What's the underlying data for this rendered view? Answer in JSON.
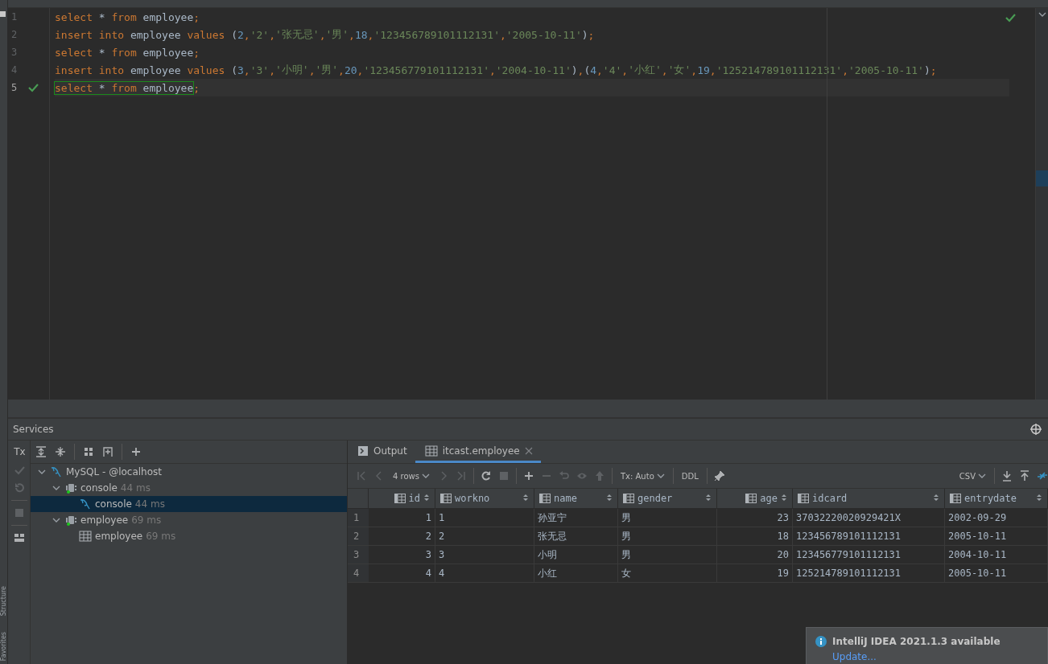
{
  "side_stripe": {
    "tabs": [
      {
        "label": "Structure"
      },
      {
        "label": "Favorites"
      }
    ]
  },
  "editor": {
    "lines": [
      {
        "number": "1",
        "executed": false,
        "tokens": [
          {
            "kind": "kw",
            "text": "select "
          },
          {
            "kind": "id",
            "text": "* "
          },
          {
            "kind": "kw",
            "text": "from "
          },
          {
            "kind": "id",
            "text": "employee"
          },
          {
            "kind": "op",
            "text": ";"
          }
        ]
      },
      {
        "number": "2",
        "executed": false,
        "tokens": [
          {
            "kind": "kw",
            "text": "insert into "
          },
          {
            "kind": "id",
            "text": "employee "
          },
          {
            "kind": "kw",
            "text": "values "
          },
          {
            "kind": "paren",
            "text": "("
          },
          {
            "kind": "num",
            "text": "2"
          },
          {
            "kind": "op",
            "text": ","
          },
          {
            "kind": "str",
            "text": "'2'"
          },
          {
            "kind": "op",
            "text": ","
          },
          {
            "kind": "str",
            "text": "'张无忌'"
          },
          {
            "kind": "op",
            "text": ","
          },
          {
            "kind": "str",
            "text": "'男'"
          },
          {
            "kind": "op",
            "text": ","
          },
          {
            "kind": "num",
            "text": "18"
          },
          {
            "kind": "op",
            "text": ","
          },
          {
            "kind": "str",
            "text": "'123456789101112131'"
          },
          {
            "kind": "op",
            "text": ","
          },
          {
            "kind": "str",
            "text": "'2005-10-11'"
          },
          {
            "kind": "paren",
            "text": ")"
          },
          {
            "kind": "op",
            "text": ";"
          }
        ]
      },
      {
        "number": "3",
        "executed": false,
        "tokens": [
          {
            "kind": "kw",
            "text": "select "
          },
          {
            "kind": "id",
            "text": "* "
          },
          {
            "kind": "kw",
            "text": "from "
          },
          {
            "kind": "id",
            "text": "employee"
          },
          {
            "kind": "op",
            "text": ";"
          }
        ]
      },
      {
        "number": "4",
        "executed": false,
        "tokens": [
          {
            "kind": "kw",
            "text": "insert into "
          },
          {
            "kind": "id",
            "text": "employee "
          },
          {
            "kind": "kw",
            "text": "values "
          },
          {
            "kind": "paren",
            "text": "("
          },
          {
            "kind": "num",
            "text": "3"
          },
          {
            "kind": "op",
            "text": ","
          },
          {
            "kind": "str",
            "text": "'3'"
          },
          {
            "kind": "op",
            "text": ","
          },
          {
            "kind": "str",
            "text": "'小明'"
          },
          {
            "kind": "op",
            "text": ","
          },
          {
            "kind": "str",
            "text": "'男'"
          },
          {
            "kind": "op",
            "text": ","
          },
          {
            "kind": "num",
            "text": "20"
          },
          {
            "kind": "op",
            "text": ","
          },
          {
            "kind": "str",
            "text": "'123456779101112131'"
          },
          {
            "kind": "op",
            "text": ","
          },
          {
            "kind": "str",
            "text": "'2004-10-11'"
          },
          {
            "kind": "paren",
            "text": ")"
          },
          {
            "kind": "op",
            "text": ","
          },
          {
            "kind": "paren",
            "text": "("
          },
          {
            "kind": "num",
            "text": "4"
          },
          {
            "kind": "op",
            "text": ","
          },
          {
            "kind": "str",
            "text": "'4'"
          },
          {
            "kind": "op",
            "text": ","
          },
          {
            "kind": "str",
            "text": "'小红'"
          },
          {
            "kind": "op",
            "text": ","
          },
          {
            "kind": "str",
            "text": "'女'"
          },
          {
            "kind": "op",
            "text": ","
          },
          {
            "kind": "num",
            "text": "19"
          },
          {
            "kind": "op",
            "text": ","
          },
          {
            "kind": "str",
            "text": "'125214789101112131'"
          },
          {
            "kind": "op",
            "text": ","
          },
          {
            "kind": "str",
            "text": "'2005-10-11'"
          },
          {
            "kind": "paren",
            "text": ")"
          },
          {
            "kind": "op",
            "text": ";"
          }
        ]
      },
      {
        "number": "5",
        "executed": true,
        "tokens": [
          {
            "kind": "kw",
            "text": "select "
          },
          {
            "kind": "id",
            "text": "* "
          },
          {
            "kind": "kw",
            "text": "from "
          },
          {
            "kind": "id",
            "text": "employee"
          },
          {
            "kind": "op",
            "text": ";"
          }
        ]
      }
    ]
  },
  "services": {
    "title": "Services",
    "side_toolbar": [
      {
        "kind": "tx",
        "label": "Tx",
        "disabled": false
      },
      {
        "kind": "commit",
        "disabled": true
      },
      {
        "kind": "rollback",
        "disabled": true
      },
      {
        "kind": "stop",
        "disabled": true
      },
      {
        "kind": "layout",
        "disabled": false
      }
    ],
    "tree_toolbar": [
      {
        "kind": "expand-all"
      },
      {
        "kind": "collapse-all"
      },
      {
        "kind": "group"
      },
      {
        "kind": "new-tab"
      },
      {
        "kind": "add"
      }
    ],
    "tree": [
      {
        "kind": "mysql",
        "label": "MySQL - @localhost",
        "expanded": true,
        "selected": false,
        "children": [
          {
            "kind": "session",
            "label": "console",
            "time": "44 ms",
            "expanded": true,
            "selected": false,
            "children": [
              {
                "kind": "mysql",
                "label": "console",
                "time": "44 ms",
                "selected": true
              }
            ]
          },
          {
            "kind": "session",
            "label": "employee",
            "time": "69 ms",
            "expanded": true,
            "selected": false,
            "children": [
              {
                "kind": "table",
                "label": "employee",
                "time": "69 ms",
                "selected": false
              }
            ]
          }
        ]
      }
    ],
    "tabs": [
      {
        "kind": "output",
        "label": "Output",
        "selected": false,
        "closable": false
      },
      {
        "kind": "table",
        "label": "itcast.employee",
        "selected": true,
        "closable": true
      }
    ],
    "results_toolbar": [
      {
        "kind": "first",
        "disabled": true
      },
      {
        "kind": "prev",
        "disabled": true
      },
      {
        "kind": "dropdown",
        "label": "4 rows",
        "disabled": false
      },
      {
        "kind": "next",
        "disabled": true
      },
      {
        "kind": "last",
        "disabled": true
      },
      {
        "kind": "sep"
      },
      {
        "kind": "refresh",
        "disabled": false
      },
      {
        "kind": "stop",
        "disabled": true
      },
      {
        "kind": "sep"
      },
      {
        "kind": "add",
        "disabled": false
      },
      {
        "kind": "remove",
        "disabled": true
      },
      {
        "kind": "revert",
        "disabled": true
      },
      {
        "kind": "preview",
        "disabled": true
      },
      {
        "kind": "submit",
        "disabled": true
      },
      {
        "kind": "sep"
      },
      {
        "kind": "dropdown",
        "label": "Tx: Auto",
        "disabled": false
      },
      {
        "kind": "sep"
      },
      {
        "kind": "text",
        "label": "DDL",
        "disabled": false
      },
      {
        "kind": "sep"
      },
      {
        "kind": "pin",
        "disabled": false
      },
      {
        "kind": "spacer"
      },
      {
        "kind": "dropdown",
        "label": "CSV",
        "disabled": false
      },
      {
        "kind": "sep"
      },
      {
        "kind": "download",
        "disabled": false
      },
      {
        "kind": "upload",
        "disabled": false
      },
      {
        "kind": "compare",
        "disabled": false
      }
    ],
    "table": {
      "columns": [
        {
          "label": "id",
          "kind": "number"
        },
        {
          "label": "workno",
          "kind": "text"
        },
        {
          "label": "name",
          "kind": "text"
        },
        {
          "label": "gender",
          "kind": "text"
        },
        {
          "label": "age",
          "kind": "number"
        },
        {
          "label": "idcard",
          "kind": "text"
        },
        {
          "label": "entrydate",
          "kind": "text"
        }
      ],
      "rows": [
        {
          "number": "1",
          "cells": [
            "1",
            "1",
            "孙亚宁",
            "男",
            "23",
            "37032220020929421X",
            "2002-09-29"
          ]
        },
        {
          "number": "2",
          "cells": [
            "2",
            "2",
            "张无忌",
            "男",
            "18",
            "123456789101112131",
            "2005-10-11"
          ]
        },
        {
          "number": "3",
          "cells": [
            "3",
            "3",
            "小明",
            "男",
            "20",
            "123456779101112131",
            "2004-10-11"
          ]
        },
        {
          "number": "4",
          "cells": [
            "4",
            "4",
            "小红",
            "女",
            "19",
            "125214789101112131",
            "2005-10-11"
          ]
        }
      ]
    }
  },
  "notification": {
    "title": "IntelliJ IDEA 2021.1.3 available",
    "link": "Update..."
  }
}
